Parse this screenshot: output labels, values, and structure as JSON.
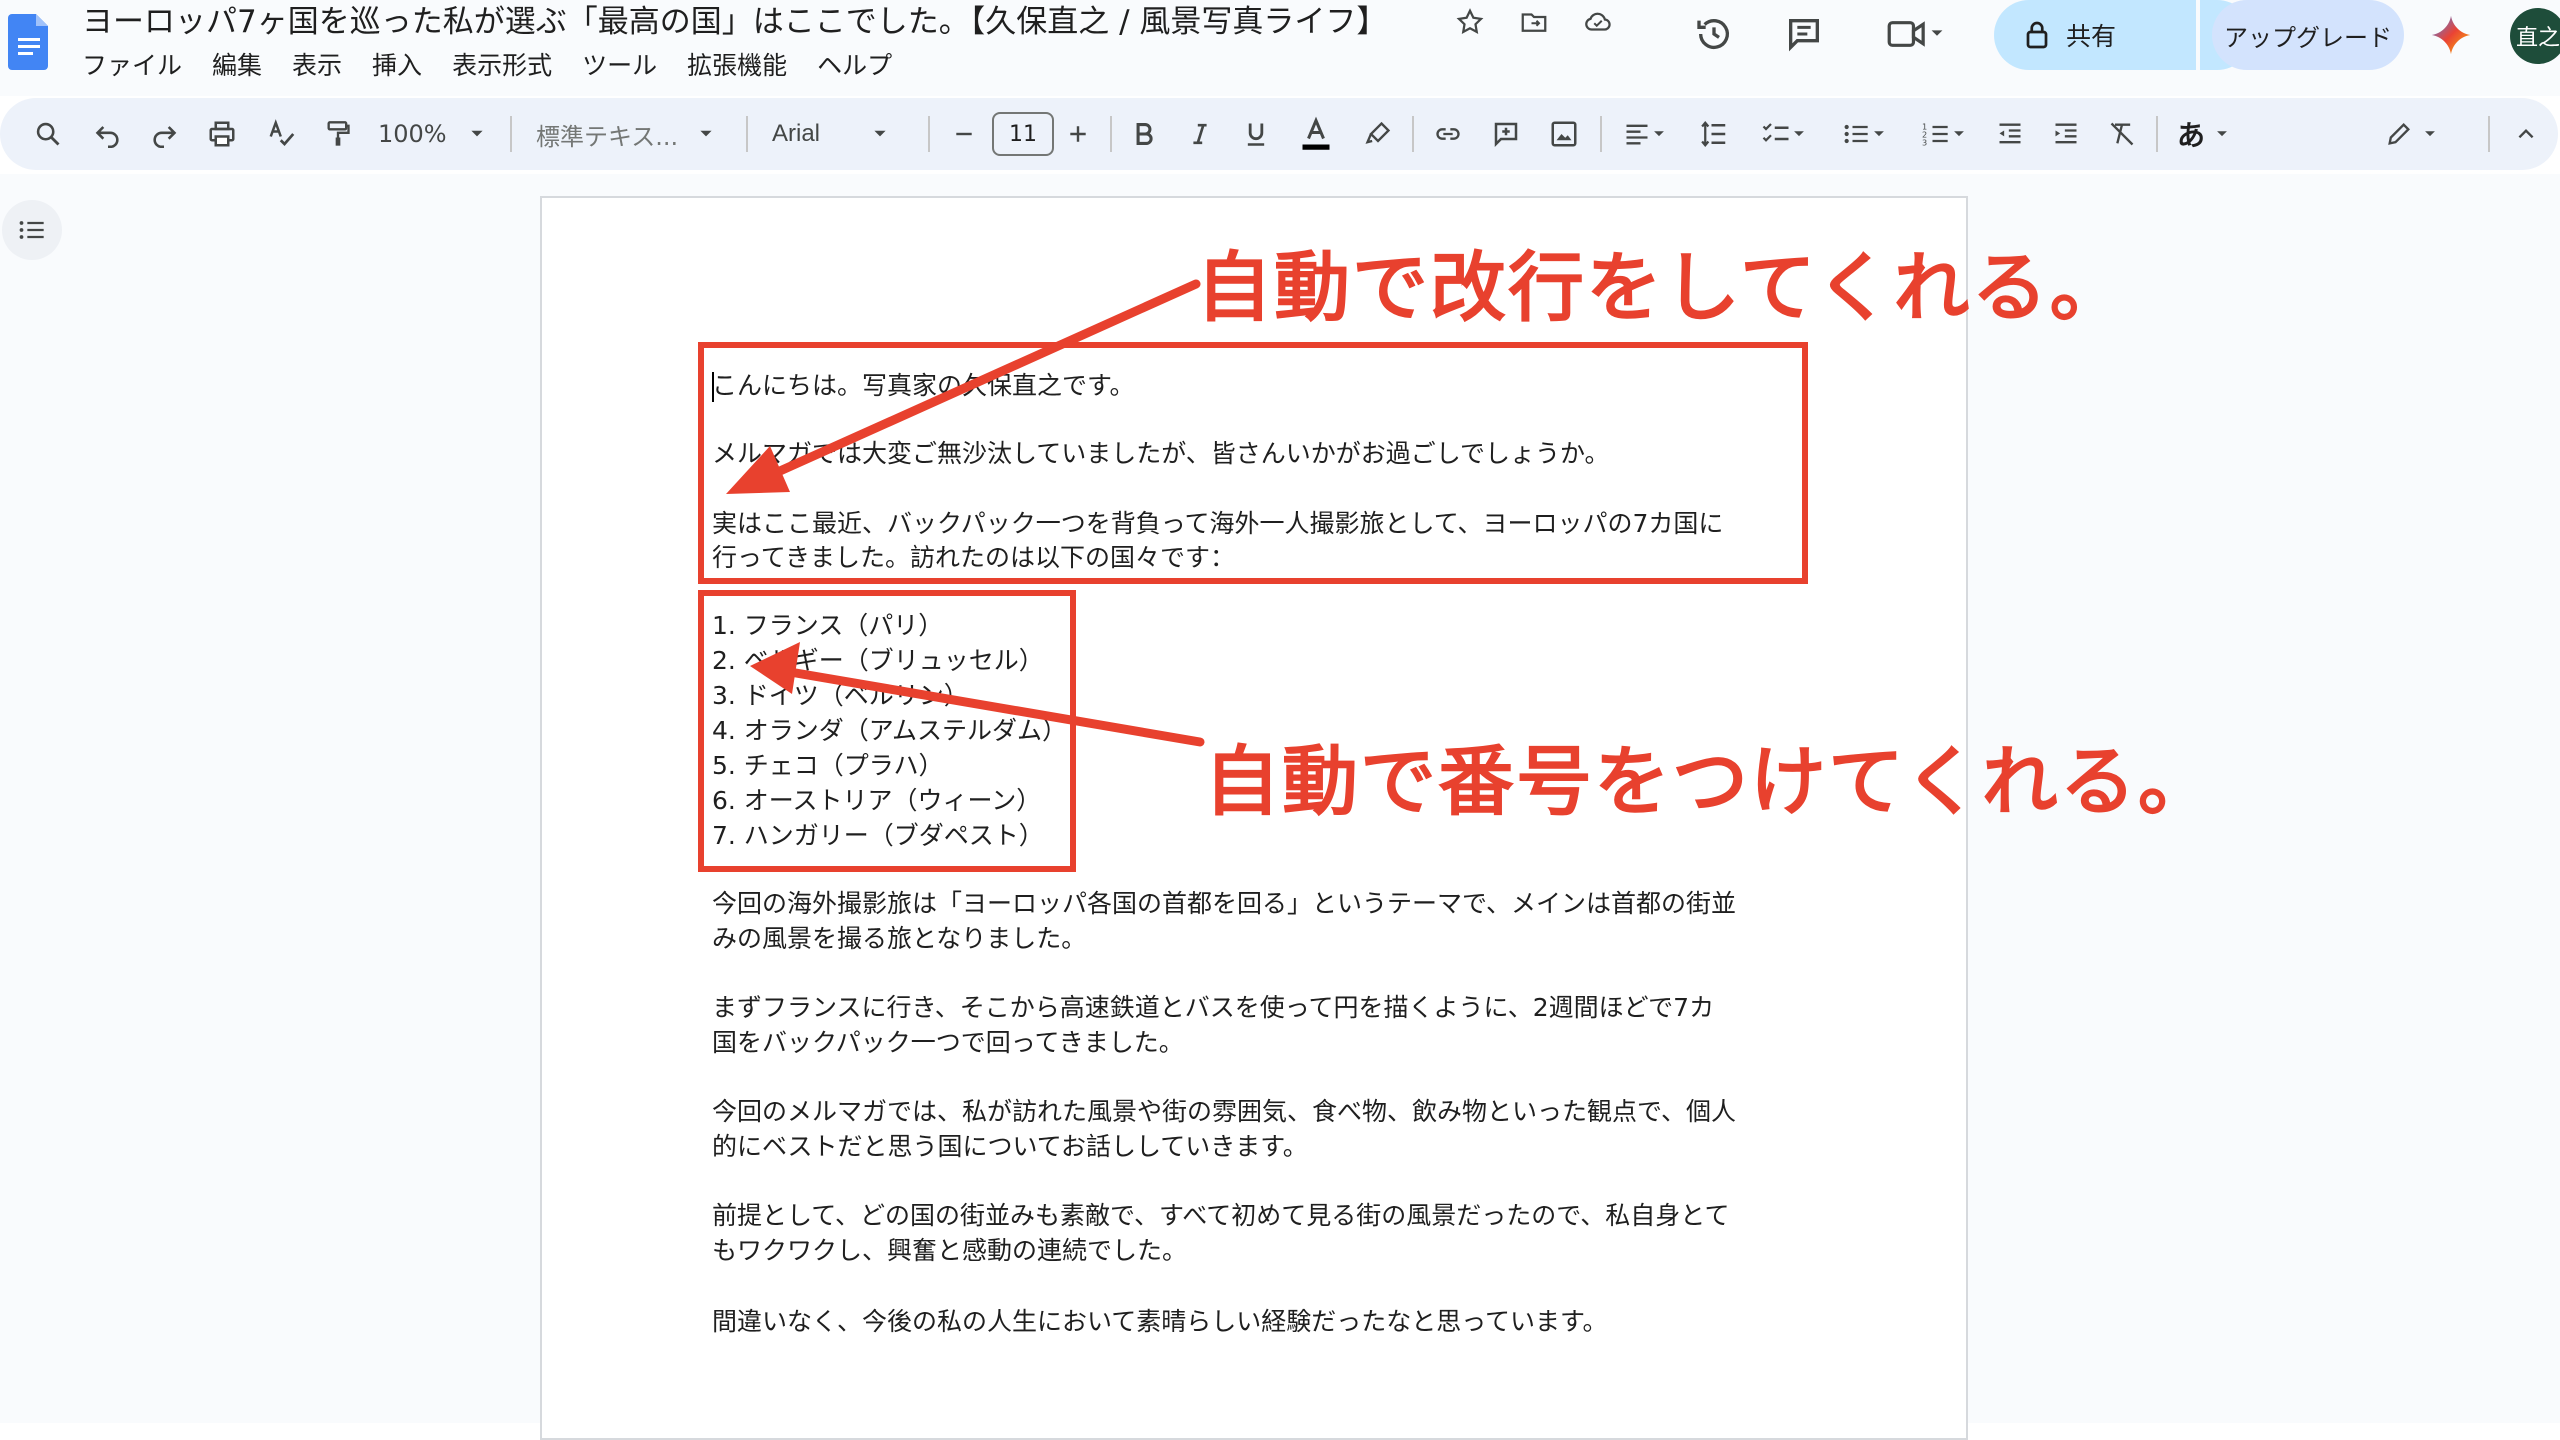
{
  "header": {
    "title": "ヨーロッパ7ヶ国を巡った私が選ぶ「最高の国」はここでした。【久保直之 / 風景写真ライフ】",
    "menus": [
      "ファイル",
      "編集",
      "表示",
      "挿入",
      "表示形式",
      "ツール",
      "拡張機能",
      "ヘルプ"
    ],
    "share_label": "共有",
    "upgrade_label": "アップグレード",
    "avatar_text": "直之",
    "colors": {
      "share_bg": "#c2e7ff",
      "upgrade_bg": "#d3e3fd",
      "doc_blue": "#4285f4"
    }
  },
  "toolbar": {
    "zoom": "100%",
    "style": "標準テキス...",
    "font": "Arial",
    "font_size": "11",
    "ime_label": "あ"
  },
  "document": {
    "paragraphs": [
      "こんにちは。写真家の久保直之です。",
      "メルマガでは大変ご無沙汰していましたが、皆さんいかがお過ごしでしょうか。",
      "実はここ最近、バックパック一つを背負って海外一人撮影旅として、ヨーロッパの7カ国に",
      "行ってきました。訪れたのは以下の国々です："
    ],
    "list": [
      "1. フランス（パリ）",
      "2. ベルギー（ブリュッセル）",
      "3. ドイツ（ベルリン）",
      "4. オランダ（アムステルダム）",
      "5. チェコ（プラハ）",
      "6. オーストリア（ウィーン）",
      "7. ハンガリー（ブダペスト）"
    ],
    "after": [
      "今回の海外撮影旅は「ヨーロッパ各国の首都を回る」というテーマで、メインは首都の街並",
      "みの風景を撮る旅となりました。",
      "まずフランスに行き、そこから高速鉄道とバスを使って円を描くように、2週間ほどで7カ",
      "国をバックパック一つで回ってきました。",
      "今回のメルマガでは、私が訪れた風景や街の雰囲気、食べ物、飲み物といった観点で、個人",
      "的にベストだと思う国についてお話ししていきます。",
      "前提として、どの国の街並みも素敵で、すべて初めて見る街の風景だったので、私自身とて",
      "もワクワクし、興奮と感動の連続でした。",
      "間違いなく、今後の私の人生において素晴らしい経験だったなと思っています。"
    ]
  },
  "annotations": {
    "line_break": "自動で改行をしてくれる。",
    "numbering": "自動で番号をつけてくれる。",
    "color": "#e8412e"
  }
}
